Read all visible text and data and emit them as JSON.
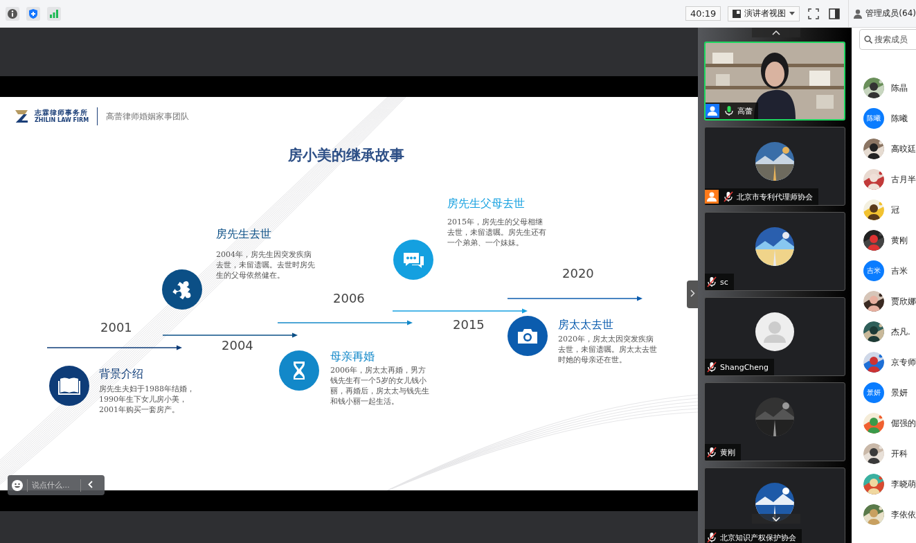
{
  "toolbar": {
    "timer": "40:19",
    "view_menu": {
      "label": "演讲者视图"
    },
    "members_button": {
      "label": "管理成员(64)"
    }
  },
  "slide": {
    "firm_name": "志霖律师事务所",
    "firm_name_en": "ZHILIN LAW FIRM",
    "team": "高蕾律师婚姻家事团队",
    "title": "房小美的继承故事",
    "events": [
      {
        "year": "2001",
        "heading": "背景介绍",
        "body": "房先生夫妇于1988年结婚，1990年生下女儿房小美，2001年购买一套房产。",
        "color": "#0e3c78"
      },
      {
        "year": "2004",
        "heading": "房先生去世",
        "body": "2004年，房先生因突发疾病去世，未留遗嘱。去世时房先生的父母依然健在。",
        "color": "#0b4f86"
      },
      {
        "year": "2006",
        "heading": "母亲再婚",
        "body": "2006年，房太太再婚，男方钱先生有一个5岁的女儿钱小丽，再婚后，房太太与钱先生和钱小丽一起生活。",
        "color": "#1288c9"
      },
      {
        "year": "2015",
        "heading": "房先生父母去世",
        "body": "2015年，房先生的父母相继去世，未留遗嘱。房先生还有一个弟弟、一个妹妹。",
        "color": "#14a0e0"
      },
      {
        "year": "2020",
        "heading": "房太太去世",
        "body": "2020年，房太太因突发疾病去世，未留遗嘱。房太太去世时她的母亲还在世。",
        "color": "#0b5cae"
      }
    ]
  },
  "chat": {
    "placeholder": "说点什么..."
  },
  "videos": [
    {
      "name": "高蕾",
      "kind": "camera",
      "speaking": true,
      "muted": false,
      "color": "#1677ff"
    },
    {
      "name": "北京市专利代理师协会",
      "kind": "picture",
      "speaking": false,
      "muted": true,
      "color": "#ff7a1a"
    },
    {
      "name": "sc",
      "kind": "picture",
      "speaking": false,
      "muted": true
    },
    {
      "name": "ShangCheng",
      "kind": "placeholder",
      "speaking": false,
      "muted": true
    },
    {
      "name": "黄刚",
      "kind": "picture",
      "speaking": false,
      "muted": true
    },
    {
      "name": "北京知识产权保护协会",
      "kind": "picture",
      "speaking": false,
      "muted": true
    }
  ],
  "members": {
    "search": {
      "placeholder": "搜索成员"
    },
    "items": [
      {
        "name": "陈晶"
      },
      {
        "name": "陈曦",
        "kind": "initials",
        "avatar_text": "陈曦"
      },
      {
        "name": "高旼廷"
      },
      {
        "name": "古月半"
      },
      {
        "name": "冠"
      },
      {
        "name": "黄刚"
      },
      {
        "name": "吉米",
        "kind": "initials",
        "avatar_text": "吉米"
      },
      {
        "name": "贾欣娜"
      },
      {
        "name": "杰凡."
      },
      {
        "name": "京专师"
      },
      {
        "name": "景妍",
        "kind": "initials",
        "avatar_text": "景妍"
      },
      {
        "name": "倔强的"
      },
      {
        "name": "开科"
      },
      {
        "name": "李晓萌"
      },
      {
        "name": "李依依"
      }
    ]
  }
}
